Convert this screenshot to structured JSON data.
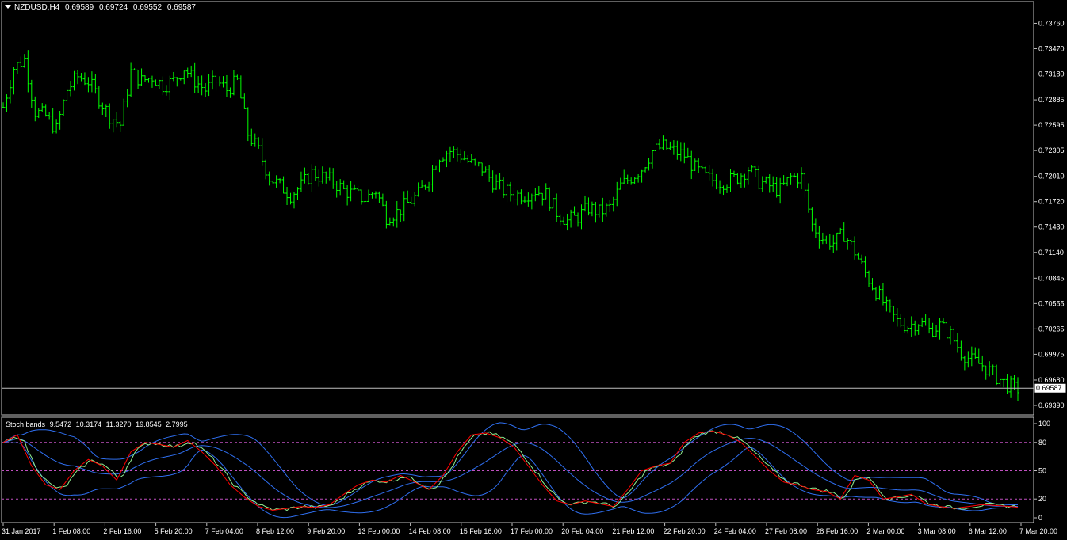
{
  "header": {
    "symbol": "NZDUSD,H4",
    "open": "0.69589",
    "high": "0.69724",
    "low": "0.69552",
    "close": "0.69587"
  },
  "indicator": {
    "name": "Stoch bands",
    "values": [
      "9.5472",
      "10.3174",
      "11.3270",
      "19.8545",
      "2.7995"
    ],
    "levels": [
      80,
      50,
      20
    ],
    "scale_labels": [
      "100",
      "80",
      "50",
      "20",
      "0"
    ]
  },
  "colors": {
    "background": "#000000",
    "bars": "#00ff00",
    "axis": "#c0c0c0",
    "stoch_main": "#ff0000",
    "stoch_signal": "#90ee90",
    "bands": "#2f6ff0",
    "level_lines": "#c050c0",
    "price_line": "#c0c0c0"
  },
  "chart_data": [
    {
      "type": "ohlc",
      "title": "NZDUSD,H4",
      "ylim": [
        0.6939,
        0.739
      ],
      "price_ticks": [
        "0.73760",
        "0.73470",
        "0.73180",
        "0.72885",
        "0.72595",
        "0.72305",
        "0.72010",
        "0.71720",
        "0.71430",
        "0.71140",
        "0.70845",
        "0.70555",
        "0.70265",
        "0.69975",
        "0.69680",
        "0.69390"
      ],
      "current_price": "0.69587",
      "time_labels": [
        "31 Jan 2017",
        "1 Feb 08:00",
        "2 Feb 16:00",
        "5 Feb 20:00",
        "7 Feb 04:00",
        "8 Feb 12:00",
        "9 Feb 20:00",
        "13 Feb 00:00",
        "14 Feb 08:00",
        "15 Feb 16:00",
        "17 Feb 00:00",
        "20 Feb 04:00",
        "21 Feb 12:00",
        "22 Feb 20:00",
        "24 Feb 04:00",
        "27 Feb 08:00",
        "28 Feb 16:00",
        "2 Mar 00:00",
        "3 Mar 08:00",
        "6 Mar 12:00",
        "7 Mar 20:00"
      ],
      "close_path": [
        [
          0,
          0.728
        ],
        [
          3,
          0.7325
        ],
        [
          6,
          0.7335
        ],
        [
          9,
          0.7275
        ],
        [
          12,
          0.727
        ],
        [
          15,
          0.7255
        ],
        [
          18,
          0.73
        ],
        [
          21,
          0.7315
        ],
        [
          24,
          0.731
        ],
        [
          27,
          0.729
        ],
        [
          30,
          0.727
        ],
        [
          33,
          0.726
        ],
        [
          36,
          0.732
        ],
        [
          39,
          0.731
        ],
        [
          42,
          0.7315
        ],
        [
          45,
          0.7305
        ],
        [
          48,
          0.731
        ],
        [
          51,
          0.7325
        ],
        [
          54,
          0.731
        ],
        [
          57,
          0.73
        ],
        [
          60,
          0.731
        ],
        [
          63,
          0.73
        ],
        [
          66,
          0.731
        ],
        [
          69,
          0.725
        ],
        [
          72,
          0.723
        ],
        [
          75,
          0.72
        ],
        [
          78,
          0.719
        ],
        [
          81,
          0.718
        ],
        [
          84,
          0.719
        ],
        [
          87,
          0.7205
        ],
        [
          90,
          0.72
        ],
        [
          93,
          0.7195
        ],
        [
          96,
          0.7185
        ],
        [
          99,
          0.718
        ],
        [
          102,
          0.7175
        ],
        [
          105,
          0.7185
        ],
        [
          108,
          0.7155
        ],
        [
          111,
          0.716
        ],
        [
          114,
          0.717
        ],
        [
          117,
          0.718
        ],
        [
          120,
          0.72
        ],
        [
          123,
          0.7225
        ],
        [
          126,
          0.723
        ],
        [
          129,
          0.7225
        ],
        [
          132,
          0.7215
        ],
        [
          135,
          0.721
        ],
        [
          138,
          0.7195
        ],
        [
          141,
          0.7185
        ],
        [
          144,
          0.718
        ],
        [
          147,
          0.718
        ],
        [
          150,
          0.7185
        ],
        [
          153,
          0.718
        ],
        [
          156,
          0.716
        ],
        [
          159,
          0.715
        ],
        [
          162,
          0.7155
        ],
        [
          165,
          0.7165
        ],
        [
          168,
          0.716
        ],
        [
          171,
          0.7165
        ],
        [
          174,
          0.719
        ],
        [
          177,
          0.72
        ],
        [
          180,
          0.721
        ],
        [
          183,
          0.723
        ],
        [
          186,
          0.7235
        ],
        [
          189,
          0.723
        ],
        [
          192,
          0.7225
        ],
        [
          195,
          0.721
        ],
        [
          198,
          0.72
        ],
        [
          201,
          0.7195
        ],
        [
          204,
          0.7195
        ],
        [
          207,
          0.72
        ],
        [
          210,
          0.721
        ],
        [
          213,
          0.7195
        ],
        [
          216,
          0.719
        ],
        [
          219,
          0.7185
        ],
        [
          222,
          0.72
        ],
        [
          225,
          0.72
        ],
        [
          228,
          0.7145
        ],
        [
          231,
          0.713
        ],
        [
          234,
          0.7125
        ],
        [
          237,
          0.7135
        ],
        [
          240,
          0.7115
        ],
        [
          243,
          0.709
        ],
        [
          246,
          0.707
        ],
        [
          249,
          0.705
        ],
        [
          252,
          0.7035
        ],
        [
          255,
          0.703
        ],
        [
          258,
          0.7035
        ],
        [
          261,
          0.7025
        ],
        [
          264,
          0.703
        ],
        [
          267,
          0.702
        ],
        [
          270,
          0.7
        ],
        [
          273,
          0.699
        ],
        [
          276,
          0.6985
        ],
        [
          279,
          0.6975
        ],
        [
          282,
          0.6965
        ],
        [
          285,
          0.6958
        ]
      ]
    },
    {
      "type": "line",
      "title": "Stoch bands",
      "ylim": [
        0,
        100
      ],
      "levels": [
        80,
        50,
        20
      ],
      "series": [
        {
          "values_at": [
            [
              0,
              80
            ],
            [
              4,
              88
            ],
            [
              8,
              55
            ],
            [
              12,
              35
            ],
            [
              16,
              30
            ],
            [
              20,
              50
            ],
            [
              24,
              62
            ],
            [
              28,
              55
            ],
            [
              32,
              40
            ],
            [
              36,
              70
            ],
            [
              40,
              80
            ],
            [
              44,
              78
            ],
            [
              48,
              75
            ],
            [
              52,
              82
            ],
            [
              56,
              70
            ],
            [
              60,
              55
            ],
            [
              64,
              35
            ],
            [
              68,
              22
            ],
            [
              72,
              12
            ],
            [
              76,
              8
            ],
            [
              80,
              10
            ],
            [
              84,
              12
            ],
            [
              88,
              11
            ],
            [
              92,
              14
            ],
            [
              96,
              25
            ],
            [
              100,
              35
            ],
            [
              104,
              40
            ],
            [
              108,
              38
            ],
            [
              112,
              45
            ],
            [
              116,
              38
            ],
            [
              120,
              30
            ],
            [
              124,
              45
            ],
            [
              128,
              70
            ],
            [
              132,
              88
            ],
            [
              136,
              90
            ],
            [
              140,
              85
            ],
            [
              144,
              75
            ],
            [
              148,
              55
            ],
            [
              152,
              35
            ],
            [
              156,
              18
            ],
            [
              160,
              14
            ],
            [
              164,
              18
            ],
            [
              168,
              15
            ],
            [
              172,
              12
            ],
            [
              176,
              30
            ],
            [
              180,
              50
            ],
            [
              184,
              55
            ],
            [
              188,
              58
            ],
            [
              192,
              80
            ],
            [
              196,
              90
            ],
            [
              200,
              92
            ],
            [
              204,
              88
            ],
            [
              208,
              80
            ],
            [
              212,
              65
            ],
            [
              216,
              50
            ],
            [
              220,
              38
            ],
            [
              224,
              35
            ],
            [
              228,
              30
            ],
            [
              232,
              28
            ],
            [
              236,
              20
            ],
            [
              240,
              45
            ],
            [
              244,
              40
            ],
            [
              248,
              20
            ],
            [
              252,
              22
            ],
            [
              256,
              25
            ],
            [
              260,
              15
            ],
            [
              264,
              12
            ],
            [
              268,
              10
            ],
            [
              272,
              12
            ],
            [
              276,
              14
            ],
            [
              280,
              13
            ],
            [
              284,
              12
            ],
            [
              287,
              11
            ]
          ]
        }
      ]
    }
  ]
}
